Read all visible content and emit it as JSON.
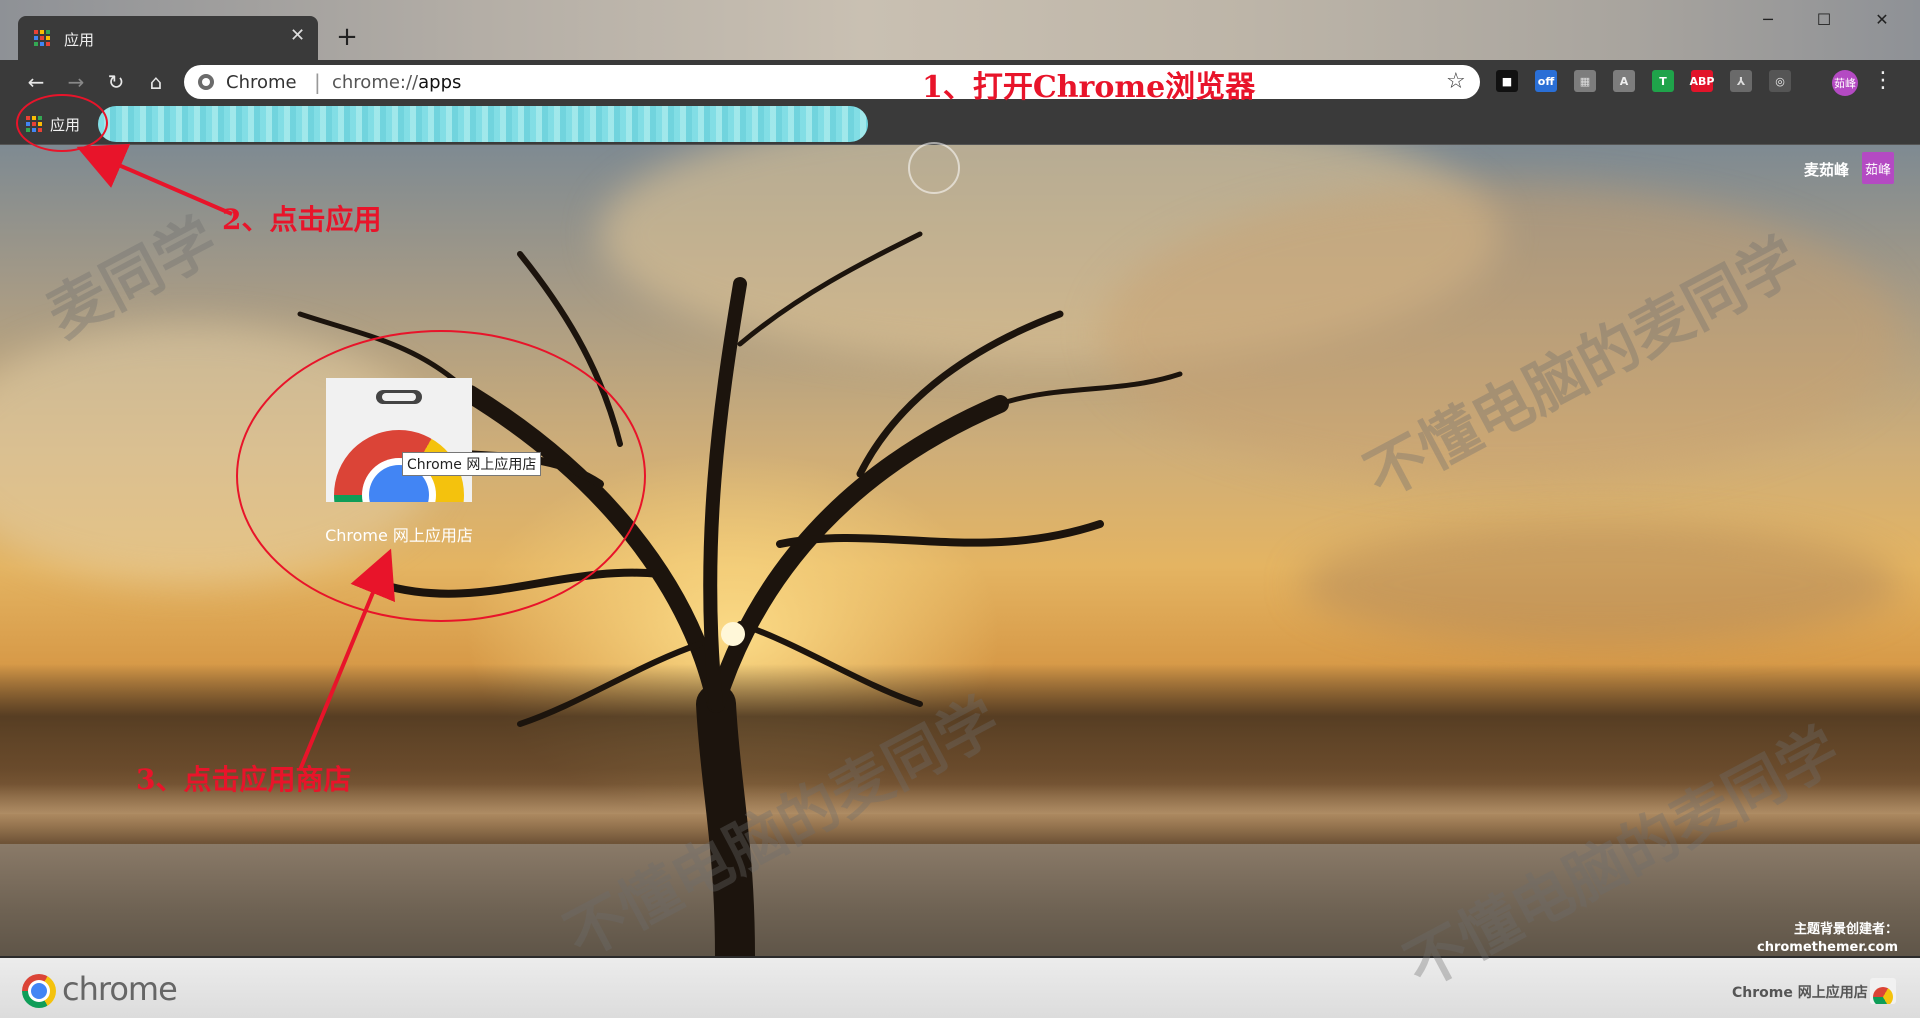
{
  "tab": {
    "title": "应用",
    "close": "✕"
  },
  "new_tab": "+",
  "window": {
    "minimize": "─",
    "maximize": "☐",
    "close": "✕"
  },
  "nav": {
    "back": "←",
    "forward": "→",
    "reload": "↻",
    "home": "⌂"
  },
  "omnibox": {
    "label": "Chrome",
    "separator": "|",
    "url_prefix": "chrome://",
    "url_path": "apps",
    "star": "☆"
  },
  "extensions": [
    {
      "name": "screen-capture-icon",
      "text": "■",
      "bg": "#111111",
      "fg": "#ffffff"
    },
    {
      "name": "off-toggle-icon",
      "text": "off",
      "bg": "#2a6fd6",
      "fg": "#ffffff"
    },
    {
      "name": "reader-icon",
      "text": "▦",
      "bg": "#7d7d7d",
      "fg": "#dddddd"
    },
    {
      "name": "translate-icon",
      "text": "A",
      "bg": "#7d7d7d",
      "fg": "#eeeeee"
    },
    {
      "name": "tampermonkey-icon",
      "text": "T",
      "bg": "#1fa34a",
      "fg": "#ffffff"
    },
    {
      "name": "adblock-plus-icon",
      "text": "ABP",
      "bg": "#e2142a",
      "fg": "#ffffff"
    },
    {
      "name": "pdf-icon",
      "text": "⅄",
      "bg": "#6a6a6a",
      "fg": "#dddddd"
    },
    {
      "name": "incognito-icon",
      "text": "◎",
      "bg": "#555555",
      "fg": "#eeeeee"
    }
  ],
  "profile_initials": "茹峰",
  "menu": "⋮",
  "bookmarks": {
    "apps_label": "应用"
  },
  "user": {
    "name": "麦茹峰",
    "avatar": "茹峰"
  },
  "app": {
    "label": "Chrome 网上应用店",
    "tooltip": "Chrome 网上应用店"
  },
  "theme_credit": {
    "line1": "主题背景创建者：",
    "line2": "chromethemer.com"
  },
  "bottom": {
    "brand": "chrome",
    "store_link": "Chrome 网上应用店"
  },
  "annotations": {
    "step1": "1、打开Chrome浏览器",
    "step2": "2、点击应用",
    "step3": "3、点击应用商店"
  },
  "watermark": [
    "麦同学",
    "不懂电脑的麦同学"
  ],
  "colors": {
    "annotation": "#e8142a",
    "avatar": "#b44ac3",
    "toolbar": "#3a3a3a"
  }
}
